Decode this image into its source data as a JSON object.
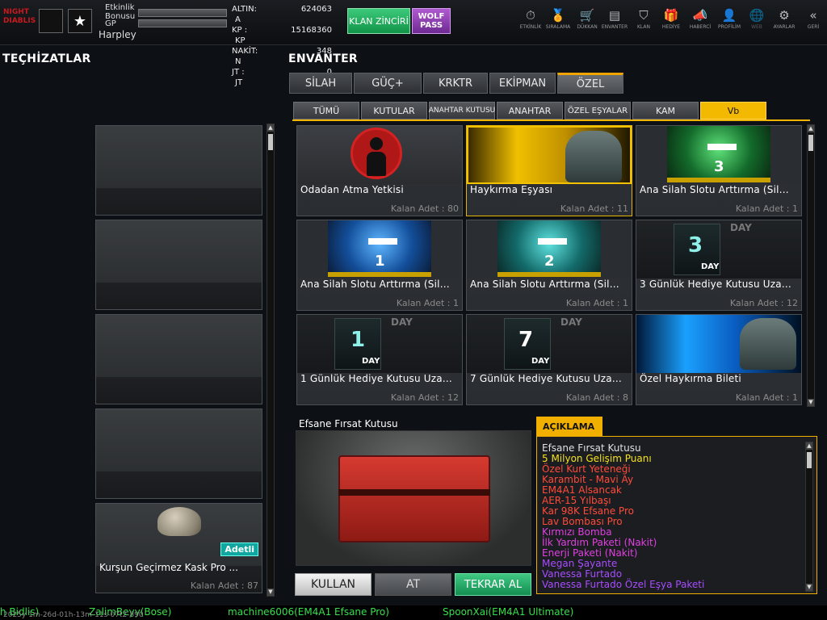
{
  "header": {
    "logo_text": "NIGHT DIABLIS",
    "stats": {
      "etkinlik_label": "Etkinlik Bonusu",
      "gp_label": "GP",
      "username": "Harpley"
    },
    "currencies": [
      {
        "label": "ALTIN:",
        "value": "624063",
        "unit": "A"
      },
      {
        "label": "KP :",
        "value": "15168360",
        "unit": "KP"
      },
      {
        "label": "NAKİT:",
        "value": "348",
        "unit": "N"
      },
      {
        "label": "JT :",
        "value": "0",
        "unit": "JT"
      }
    ],
    "klan_button": "KLAN ZİNCİRİ",
    "wolf_button": "WOLF PASS",
    "nav": [
      "ETKİNLİK",
      "SIRALAMA",
      "DÜKKAN",
      "ENVANTER",
      "KLAN",
      "HEDİYE",
      "HABERCİ",
      "PROFİLİM",
      "WEB",
      "AYARLAR",
      "GERİ"
    ]
  },
  "left": {
    "title": "TEÇHİZATLAR",
    "equipped": {
      "name": "Kurşun Geçirmez Kask Pro ...",
      "count": "Kalan Adet : 87",
      "badge": "Adetli"
    }
  },
  "inventory": {
    "title": "ENVANTER",
    "tabs": [
      "SİLAH",
      "GÜÇ+",
      "KRKTR",
      "EKİPMAN",
      "ÖZEL"
    ],
    "subtabs": [
      "TÜMÜ",
      "KUTULAR",
      "ANAHTAR KUTUSU",
      "ANAHTAR",
      "ÖZEL EŞYALAR",
      "KAM",
      "Vb"
    ],
    "items": [
      {
        "name": "Odadan Atma Yetkisi",
        "count": "Kalan Adet : 80"
      },
      {
        "name": "Haykırma Eşyası",
        "count": "Kalan Adet : 11"
      },
      {
        "name": "Ana Silah Slotu Arttırma (Sil...",
        "count": "Kalan Adet : 1",
        "digit": "3"
      },
      {
        "name": "Ana Silah Slotu Arttırma (Sil...",
        "count": "Kalan Adet : 1",
        "digit": "1"
      },
      {
        "name": "Ana Silah Slotu Arttırma (Sil...",
        "count": "Kalan Adet : 1",
        "digit": "2"
      },
      {
        "name": "3 Günlük Hediye Kutusu Uza...",
        "count": "Kalan Adet : 12",
        "digit": "3",
        "day": "DAY"
      },
      {
        "name": "1 Günlük Hediye Kutusu Uza...",
        "count": "Kalan Adet : 12",
        "digit": "1",
        "day": "DAY"
      },
      {
        "name": "7 Günlük Hediye Kutusu Uza...",
        "count": "Kalan Adet : 8",
        "digit": "7",
        "day": "DAY"
      },
      {
        "name": "Özel Haykırma Bileti",
        "count": "Kalan Adet : 1"
      }
    ]
  },
  "selected": {
    "title": "Efsane Fırsat Kutusu"
  },
  "description": {
    "title": "AÇIKLAMA",
    "lines": [
      {
        "text": "Efsane Fırsat Kutusu",
        "color": "#e0e0e0"
      },
      {
        "text": "5 Milyon Gelişim Puanı",
        "color": "#f4e21c"
      },
      {
        "text": "Özel Kurt Yeteneği",
        "color": "#ff4b3a"
      },
      {
        "text": "Karambit - Mavi Ay",
        "color": "#ff4b3a"
      },
      {
        "text": "EM4A1 Alsancak",
        "color": "#ff4b3a"
      },
      {
        "text": "AER-15 Yılbaşı",
        "color": "#ff4b3a"
      },
      {
        "text": "Kar 98K Efsane Pro",
        "color": "#ff4b3a"
      },
      {
        "text": "Lav Bombası Pro",
        "color": "#ff4b3a"
      },
      {
        "text": "Kırmızı Bomba",
        "color": "#e040e0"
      },
      {
        "text": "İlk Yardım Paketi (Nakit)",
        "color": "#e040e0"
      },
      {
        "text": "Enerji Paketi (Nakit)",
        "color": "#e040e0"
      },
      {
        "text": "Megan Şayante",
        "color": "#a84cff"
      },
      {
        "text": "Vanessa Furtado",
        "color": "#a84cff"
      },
      {
        "text": "Vanessa Furtado Özel Eşya Paketi",
        "color": "#a84cff"
      }
    ]
  },
  "actions": {
    "use": "KULLAN",
    "drop": "AT",
    "repeat": "TEKRAR AL"
  },
  "ticker": [
    "h Bidlis)",
    "ZalimBeyy(Bose)",
    "machine6006(EM4A1 Efsane Pro)",
    "SpoonXai(EM4A1 Ultimate)"
  ],
  "timestamp": "2025y 1m-26d-01h-13m-11s-07t2-890"
}
